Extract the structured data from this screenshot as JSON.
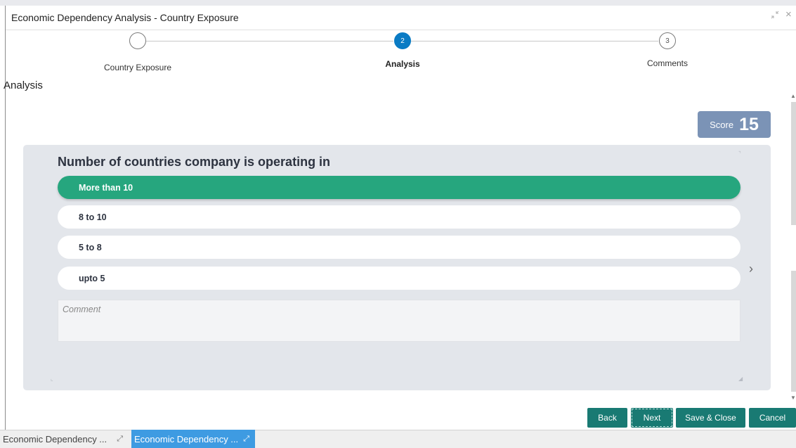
{
  "window": {
    "title": "Economic Dependency Analysis - Country Exposure",
    "restore_icon": "minimize-arrows-icon",
    "close_label": "×"
  },
  "stepper": {
    "steps": [
      {
        "number": "",
        "label": "Country Exposure",
        "state": "completed"
      },
      {
        "number": "2",
        "label": "Analysis",
        "state": "active"
      },
      {
        "number": "3",
        "label": "Comments",
        "state": "pending"
      }
    ]
  },
  "section": {
    "title": "Analysis"
  },
  "score": {
    "label": "Score",
    "value": "15"
  },
  "question": {
    "text": "Number of countries company is operating in",
    "options": [
      {
        "label": "More than 10",
        "selected": true
      },
      {
        "label": "8 to 10",
        "selected": false
      },
      {
        "label": "5 to 8",
        "selected": false
      },
      {
        "label": "upto 5",
        "selected": false
      }
    ],
    "comment_placeholder": "Comment",
    "next_arrow": "›"
  },
  "footer": {
    "back": "Back",
    "next": "Next",
    "save_close": "Save & Close",
    "cancel": "Cancel"
  },
  "taskbar": {
    "items": [
      {
        "label": "Economic Dependency ...",
        "active": false
      },
      {
        "label": "Economic Dependency ...",
        "active": true
      }
    ]
  },
  "colors": {
    "accent_blue": "#0a7bc4",
    "selected_green": "#26a67e",
    "button_teal": "#197a73",
    "score_bg": "#7b93b6",
    "taskbar_active": "#3e9be2"
  }
}
